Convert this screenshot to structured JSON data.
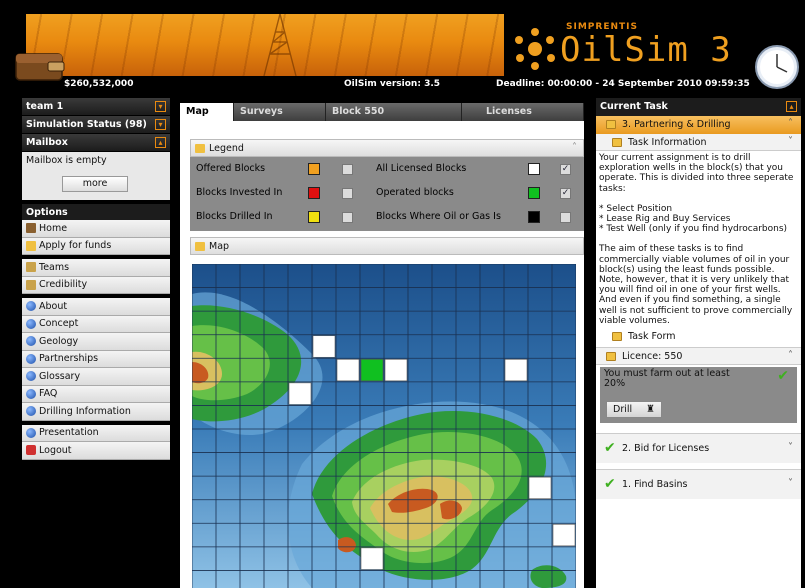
{
  "header": {
    "logo_brand": "SIMPRENTIS",
    "logo_title": "OilSim 3",
    "wallet_amount": "$260,532,000",
    "version": "OilSim version: 3.5",
    "deadline": "Deadline: 00:00:00 - 24 September 2010 09:59:35"
  },
  "sidebar": {
    "team": "team 1",
    "simulation_status": "Simulation Status (98)",
    "mailbox_title": "Mailbox",
    "mailbox_text": "Mailbox is empty",
    "more_label": "more",
    "options_title": "Options",
    "group1": [
      {
        "label": "Home",
        "icon": "home-icon"
      },
      {
        "label": "Apply for funds",
        "icon": "folder-icon"
      }
    ],
    "group2": [
      {
        "label": "Teams",
        "icon": "teams-icon"
      },
      {
        "label": "Credibility",
        "icon": "credibility-icon"
      }
    ],
    "group3": [
      {
        "label": "About",
        "icon": "globe-icon"
      },
      {
        "label": "Concept",
        "icon": "globe-icon"
      },
      {
        "label": "Geology",
        "icon": "globe-icon"
      },
      {
        "label": "Partnerships",
        "icon": "globe-icon"
      },
      {
        "label": "Glossary",
        "icon": "globe-icon"
      },
      {
        "label": "FAQ",
        "icon": "globe-icon"
      },
      {
        "label": "Drilling Information",
        "icon": "globe-icon"
      }
    ],
    "group4": [
      {
        "label": "Presentation",
        "icon": "globe-icon"
      },
      {
        "label": "Logout",
        "icon": "logout-icon"
      }
    ]
  },
  "tabs": [
    "Map",
    "Surveys",
    "Block 550",
    "Licenses"
  ],
  "legend": {
    "title": "Legend",
    "items": [
      {
        "label": "Offered Blocks",
        "color": "#f0a020",
        "checked": false
      },
      {
        "label": "All Licensed Blocks",
        "color": "#ffffff",
        "checked": true
      },
      {
        "label": "Blocks Invested In",
        "color": "#e01010",
        "checked": false
      },
      {
        "label": "Operated blocks",
        "color": "#10c020",
        "checked": true
      },
      {
        "label": "Blocks Drilled In",
        "color": "#f0e010",
        "checked": false
      },
      {
        "label": "Blocks Where Oil or Gas Is",
        "color": "#000000",
        "checked": false
      }
    ]
  },
  "map": {
    "title": "Map",
    "grid_cols": 16,
    "grid_rows": 14,
    "licensed_blocks": [
      [
        5,
        3
      ],
      [
        6,
        4
      ],
      [
        8,
        4
      ],
      [
        13,
        4
      ],
      [
        4,
        5
      ],
      [
        14,
        9
      ],
      [
        15,
        11
      ],
      [
        7,
        12
      ]
    ],
    "operated_blocks": [
      [
        7,
        4
      ]
    ]
  },
  "task": {
    "header": "Current Task",
    "active": "3. Partnering & Drilling",
    "info_title": "Task Information",
    "paragraph1": "Your current assignment is to drill exploration wells in the block(s) that you operate. This is divided into three seperate tasks:",
    "steps": [
      "* Select Position",
      "* Lease Rig and Buy Services",
      "* Test Well (only if you find hydrocarbons)"
    ],
    "paragraph2": "The aim of these tasks is to find commercially viable volumes of oil in your block(s) using the least funds possible.",
    "paragraph3": "Note, however, that it is very unlikely that you will find oil in one of your first wells. And even if you find something, a single well is not sufficient to prove commercially viable volumes.",
    "form_title": "Task Form",
    "licence": "Licence: 550",
    "farm_out": "You must farm out at least 20%",
    "drill_label": "Drill",
    "completed": [
      "2. Bid for Licenses",
      "1. Find Basins"
    ]
  }
}
